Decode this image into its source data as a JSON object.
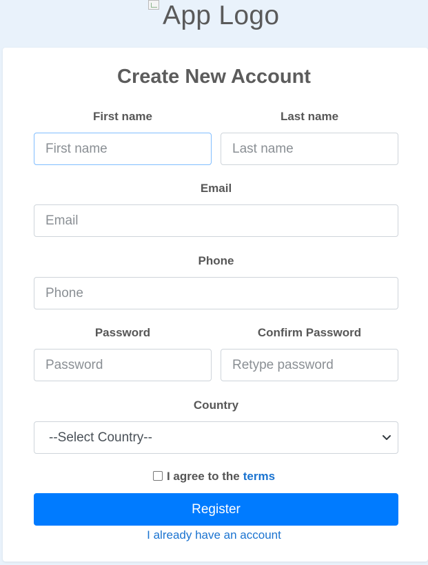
{
  "header": {
    "logo_alt": "App Logo"
  },
  "form": {
    "title": "Create New Account",
    "first_name": {
      "label": "First name",
      "placeholder": "First name"
    },
    "last_name": {
      "label": "Last name",
      "placeholder": "Last name"
    },
    "email": {
      "label": "Email",
      "placeholder": "Email"
    },
    "phone": {
      "label": "Phone",
      "placeholder": "Phone"
    },
    "password": {
      "label": "Password",
      "placeholder": "Password"
    },
    "confirm_password": {
      "label": "Confirm Password",
      "placeholder": "Retype password"
    },
    "country": {
      "label": "Country",
      "selected": "--Select Country--"
    },
    "terms": {
      "prefix": "I agree to the",
      "link": "terms",
      "checked": false
    },
    "register_label": "Register",
    "login_link": "I already have an account"
  },
  "colors": {
    "page_bg": "#e9f2fb",
    "primary": "#007bff",
    "link": "#1a73d0",
    "focus_border": "#80bdff"
  },
  "icons": {
    "select_arrow": "chevron-down-icon",
    "logo_image": "broken-image-icon"
  }
}
